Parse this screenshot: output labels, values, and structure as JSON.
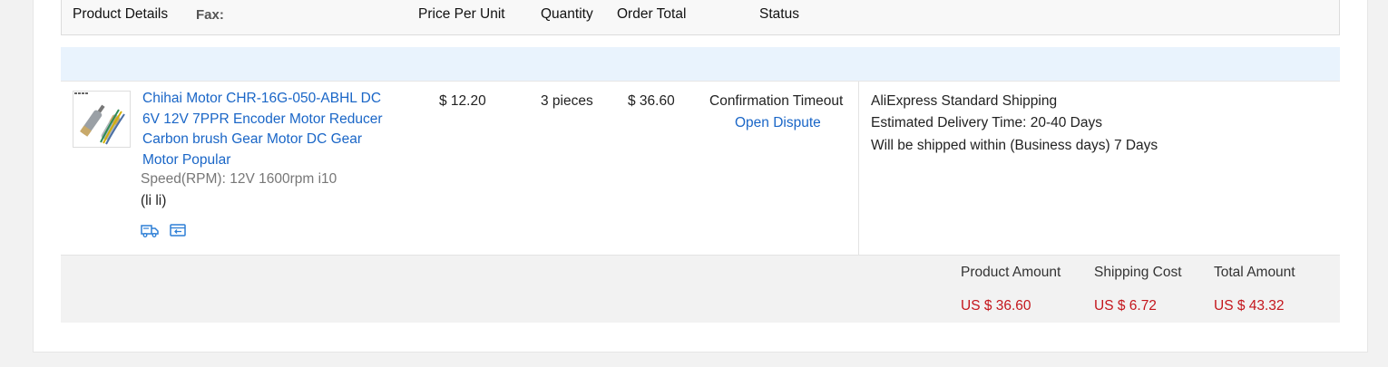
{
  "address": {
    "fax_label": "Fax:"
  },
  "table": {
    "headers": {
      "product_details": "Product Details",
      "price_per_unit": "Price Per Unit",
      "quantity": "Quantity",
      "order_total": "Order Total",
      "status": "Status"
    }
  },
  "item": {
    "title": "Chihai Motor CHR-16G-050-ABHL DC 6V 12V 7PPR Encoder Motor Reducer Carbon brush Gear Motor DC Gear Motor Popular",
    "sku": "Speed(RPM): 12V 1600rpm i10",
    "sku_extra": "(li li)",
    "price": "$ 12.20",
    "quantity": "3 pieces",
    "order_total": "$ 36.60",
    "status": "Confirmation Timeout",
    "dispute_link": "Open Dispute",
    "icons": [
      "truck-icon",
      "return-icon"
    ]
  },
  "shipping": {
    "method": "AliExpress Standard Shipping",
    "estimated_label": "Estimated Delivery Time:",
    "estimated_value": "20-40 Days",
    "ship_within_label": "Will be shipped within (Business days)",
    "ship_within_value": "7 Days"
  },
  "summary": {
    "product_amount_label": "Product Amount",
    "product_amount": "US $ 36.60",
    "shipping_cost_label": "Shipping Cost",
    "shipping_cost": "US $ 6.72",
    "total_amount_label": "Total Amount",
    "total_amount": "US $ 43.32"
  },
  "colors": {
    "link": "#1a66c7",
    "price_red": "#c4161c",
    "header_bg": "#e9f3fd"
  }
}
